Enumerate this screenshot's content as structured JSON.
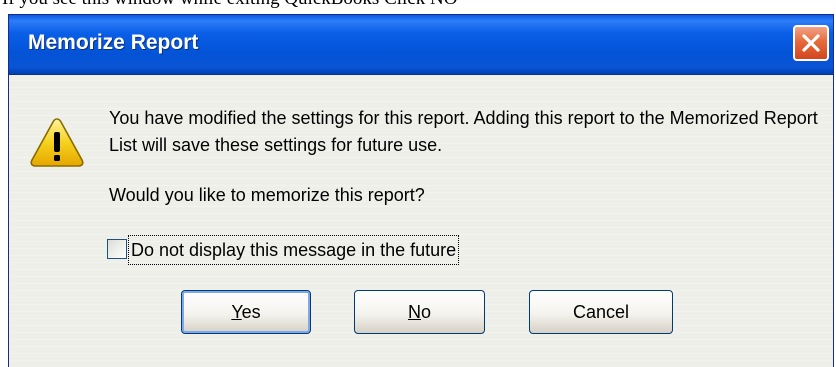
{
  "caption": "If you see this window while exiting QuickBooks Click NO",
  "dialog": {
    "title": "Memorize Report",
    "close_icon": "close-icon",
    "warning_icon": "warning-icon",
    "message": "You have modified the settings for this report. Adding this report to the Memorized Report List will save these settings for future use.",
    "question": "Would you like to memorize this report?",
    "checkbox": {
      "label": "Do not display this message in the future",
      "checked": false
    },
    "buttons": {
      "yes_mnemonic": "Y",
      "yes_rest": "es",
      "no_mnemonic": "N",
      "no_rest": "o",
      "cancel_label": "Cancel"
    }
  },
  "colors": {
    "titlebar": "#0453d6",
    "close_button": "#e66a3d",
    "warning_fill": "#f5d21d",
    "dialog_bg": "#efefea"
  }
}
